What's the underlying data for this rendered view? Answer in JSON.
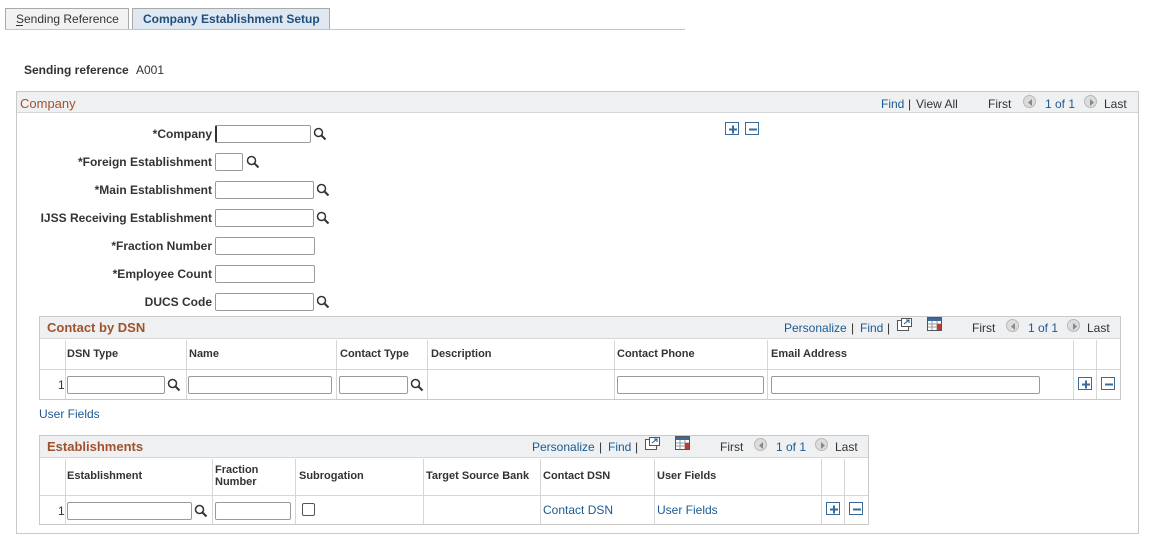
{
  "tabs": [
    "Sending Reference",
    "Company Establishment Setup"
  ],
  "sending_reference": {
    "label": "Sending reference",
    "value": "A001"
  },
  "company": {
    "title": "Company",
    "nav": {
      "find": "Find",
      "view_all": "View All",
      "first": "First",
      "count": "1 of 1",
      "last": "Last",
      "separator": "|"
    },
    "fields": {
      "company": "*Company",
      "foreign": "*Foreign Establishment",
      "main": "*Main Establishment",
      "ijss": "IJSS Receiving Establishment",
      "fraction": "*Fraction Number",
      "employee": "*Employee Count",
      "ducs": "DUCS Code"
    }
  },
  "contact_grid": {
    "title": "Contact by DSN",
    "nav": {
      "personalize": "Personalize",
      "find": "Find",
      "first": "First",
      "count": "1 of 1",
      "last": "Last",
      "separator": "|"
    },
    "columns": [
      "DSN Type",
      "Name",
      "Contact Type",
      "Description",
      "Contact Phone",
      "Email Address"
    ],
    "row_number": "1"
  },
  "user_fields_link": "User Fields",
  "establishments_grid": {
    "title": "Establishments",
    "nav": {
      "personalize": "Personalize",
      "find": "Find",
      "first": "First",
      "count": "1 of 1",
      "last": "Last",
      "separator": "|"
    },
    "columns": [
      "Establishment",
      "Fraction Number",
      "Subrogation",
      "Target Source Bank",
      "Contact DSN",
      "User Fields"
    ],
    "row_number": "1",
    "row_links": {
      "contact_dsn": "Contact DSN",
      "user_fields": "User Fields"
    }
  },
  "colors": {
    "accent": "#a0522d",
    "link": "#1d5a93",
    "header_bg": "#eef0f2",
    "border": "#c9c9c9"
  }
}
